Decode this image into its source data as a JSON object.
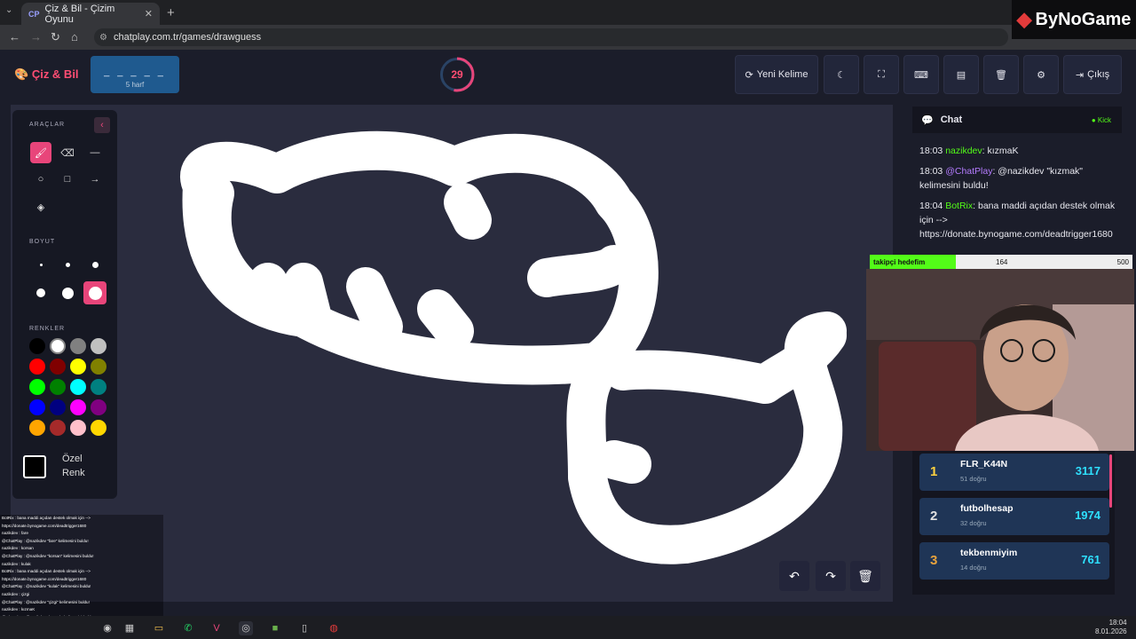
{
  "browser": {
    "tab_title": "Çiz & Bil - Çizim Oyunu",
    "tab_favicon": "CP",
    "url": "chatplay.com.tr/games/drawguess",
    "new_tab_label": "+",
    "overlay_brand": "ByNoGame"
  },
  "header": {
    "brand": "Çiz & Bil",
    "word_mask": "_ _ _ _ _",
    "word_hint": "5 harf",
    "timer": "29",
    "buttons": {
      "new_word": "Yeni Kelime",
      "exit": "Çıkış"
    }
  },
  "tools": {
    "title": "ARAÇLAR",
    "size_title": "BOYUT",
    "colors_title": "RENKLER",
    "custom_color": "Özel Renk",
    "palette": [
      "#000000",
      "#ffffff",
      "#808080",
      "#c0c0c0",
      "#ff0000",
      "#800000",
      "#ffff00",
      "#808000",
      "#00ff00",
      "#008000",
      "#00ffff",
      "#008080",
      "#0000ff",
      "#000080",
      "#ff00ff",
      "#800080",
      "#ffa500",
      "#a52a2a",
      "#ffc0cb",
      "#ffd700"
    ],
    "selected_color": "#ffffff"
  },
  "chat": {
    "title": "Chat",
    "platform": "Kick",
    "messages": [
      {
        "time": "18:03",
        "user": "nazikdev",
        "user_color": "#53fc18",
        "text": ": kızmaK"
      },
      {
        "time": "18:03",
        "user": "@ChatPlay",
        "user_color": "#b57cff",
        "text": ": @nazikdev \"kızmak\" kelimesini buldu!"
      },
      {
        "time": "18:04",
        "user": "BotRix",
        "user_color": "#53fc18",
        "text": ": bana maddi açıdan destek olmak için --> https://donate.bynogame.com/deadtrigger1680"
      }
    ]
  },
  "goal": {
    "label": "takipçi hedefim",
    "current": "164",
    "target": "500",
    "progress": 0.328
  },
  "leaderboard": [
    {
      "rank": "1",
      "name": "FLR_K44N",
      "sub": "51 doğru",
      "score": "3117",
      "rank_color": "#ffd23f"
    },
    {
      "rank": "2",
      "name": "futbolhesap",
      "sub": "32 doğru",
      "score": "1974",
      "rank_color": "#e0e0e0"
    },
    {
      "rank": "3",
      "name": "tekbenmiyim",
      "sub": "14 doğru",
      "score": "761",
      "rank_color": "#e8a33d"
    }
  ],
  "overlay_chat": [
    "BotRix : bana maddi açıdan destek olmak için -->",
    "https://donate.bynogame.com/deadtrigger1680",
    "nazikdev : fare",
    "@ChatPlay : @nazikdev \"fare\" kelimesini buldu!",
    "nazikdev : korsan",
    "@ChatPlay : @nazikdev \"korsan\" kelimesini buldu!",
    "nazikdev : kulak",
    "BotRix : bana maddi açıdan destek olmak için -->",
    "https://donate.bynogame.com/deadtrigger1680",
    "@ChatPlay : @nazikdev \"kulak\" kelimesini buldu!",
    "nazikdev : çizgi",
    "@ChatPlay : @nazikdev \"çizgi\" kelimesini buldu!",
    "nazikdev : kızmaK",
    "@ChatPlay : @nazikdev \"kızmak\" kelimesini buldu!",
    "BotRix : bana maddi açıdan destek olmak için -->",
    "https://donate.bynogame.com/deadtrigger1680"
  ],
  "clock": {
    "time": "18:04",
    "date": "8.01.2026"
  },
  "icons": [
    "brush-icon",
    "eraser-icon",
    "line-icon",
    "circle-icon",
    "square-icon",
    "arrow-icon",
    "fill-icon",
    "undo-icon",
    "redo-icon",
    "trash-icon",
    "refresh-icon",
    "moon-icon",
    "fullscreen-icon",
    "keyboard-icon",
    "archive-icon",
    "gear-icon",
    "logout-icon",
    "chat-icon"
  ]
}
